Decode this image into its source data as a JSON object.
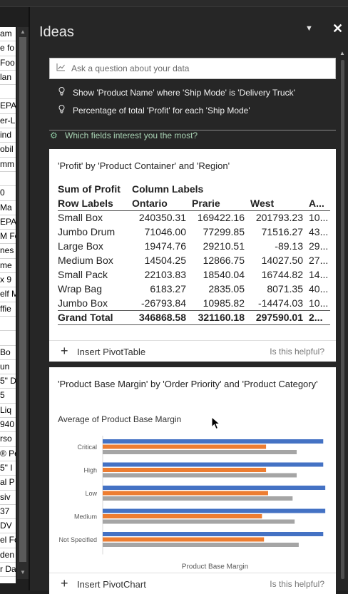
{
  "sheet": {
    "cells": [
      "am",
      "e fo",
      " Foo",
      "lan",
      "",
      "EPA",
      "er-L",
      "ind",
      "obil",
      "mm",
      "",
      "0",
      "Ma",
      "EPA",
      "M Fo",
      "nes",
      "me",
      " x 9",
      "elf M",
      "ffie",
      "",
      "",
      "Bo",
      "un",
      "5\" D",
      "5",
      "Liq",
      "940",
      "rso",
      "® Pe",
      "5\" I",
      "al P",
      "siv",
      "37",
      " DV",
      "el Fo",
      "den",
      "r Da"
    ]
  },
  "pane": {
    "title": "Ideas",
    "ask_placeholder": "Ask a question about your data",
    "suggestions": [
      "Show 'Product Name' where 'Ship Mode' is 'Delivery Truck'",
      "Percentage of total 'Profit' for each 'Ship Mode'"
    ],
    "fields_prompt": "Which fields interest you the most?",
    "helpful_text": "Is this helpful?"
  },
  "card1": {
    "title": "'Profit' by 'Product Container' and 'Region'",
    "header_row1": [
      "Sum of Profit",
      "Column Labels",
      "",
      "",
      ""
    ],
    "header_row2": [
      "Row Labels",
      "Ontario",
      "Prarie",
      "West",
      "A..."
    ],
    "rows": [
      [
        "Small Box",
        "240350.31",
        "169422.16",
        "201793.23",
        "10..."
      ],
      [
        "Jumbo Drum",
        "71046.00",
        "77299.85",
        "71516.27",
        "43..."
      ],
      [
        "Large Box",
        "19474.76",
        "29210.51",
        "-89.13",
        "29..."
      ],
      [
        "Medium Box",
        "14504.25",
        "12866.75",
        "14027.50",
        "27..."
      ],
      [
        "Small Pack",
        "22103.83",
        "18540.04",
        "16744.82",
        "14..."
      ],
      [
        "Wrap Bag",
        "6183.27",
        "2835.05",
        "8071.35",
        "40..."
      ],
      [
        "Jumbo Box",
        "-26793.84",
        "10985.82",
        "-14474.03",
        "10..."
      ]
    ],
    "total_row": [
      "Grand Total",
      "346868.58",
      "321160.18",
      "297590.01",
      "2..."
    ],
    "action_label": "Insert PivotTable"
  },
  "card2": {
    "title": "'Product Base Margin' by 'Order Priority' and 'Product Category'",
    "subtitle": "Average of Product Base Margin",
    "action_label": "Insert PivotChart"
  },
  "chart_data": {
    "type": "bar",
    "orientation": "horizontal",
    "categories": [
      "Critical",
      "High",
      "Low",
      "Medium",
      "Not Specified"
    ],
    "series": [
      {
        "values": [
          0.54,
          0.54,
          0.545,
          0.545,
          0.54
        ],
        "color": "#4472c4"
      },
      {
        "values": [
          0.4,
          0.4,
          0.405,
          0.39,
          0.395
        ],
        "color": "#ed7d31"
      },
      {
        "values": [
          0.475,
          0.475,
          0.465,
          0.47,
          0.48
        ],
        "color": "#a5a5a5"
      }
    ],
    "xlabel": "Product Base Margin",
    "xlim": [
      0,
      0.55
    ],
    "grid": false,
    "legend": "none"
  },
  "colors": {
    "accent_green": "#a9d3b4",
    "bar_blue": "#4472c4",
    "bar_orange": "#ed7d31",
    "bar_gray": "#a5a5a5"
  }
}
